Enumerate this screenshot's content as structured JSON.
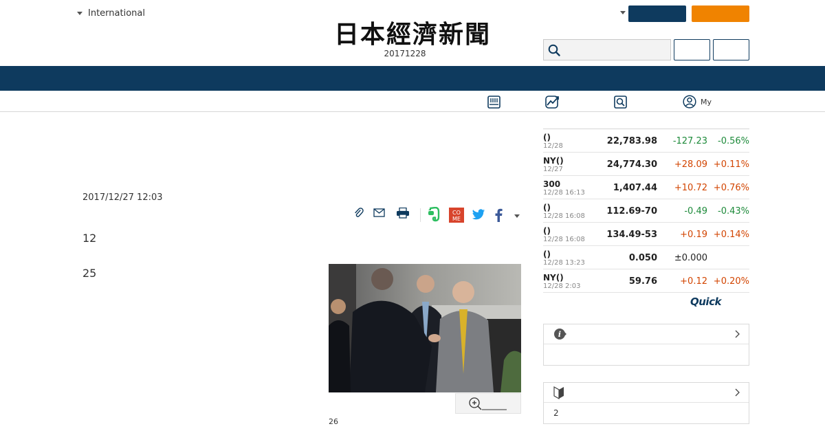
{
  "header": {
    "edition_label": "International",
    "logo_text": "日本經濟新聞",
    "logo_date": "20171228",
    "search": {
      "value": "",
      "placeholder": ""
    }
  },
  "subnav": {
    "items": [
      {
        "icon": "newspaper-icon",
        "label": ""
      },
      {
        "icon": "chart-icon",
        "label": ""
      },
      {
        "icon": "search-icon",
        "label": ""
      },
      {
        "icon": "user-icon",
        "label": "My"
      }
    ]
  },
  "article": {
    "date": "2017/12/27 12:03",
    "paragraph_1": "12",
    "paragraph_2": "25",
    "caption": "26"
  },
  "market": {
    "rows": [
      {
        "name": "()",
        "time": "12/28",
        "value": "22,783.98",
        "change": "-127.23",
        "pct": "-0.56%",
        "dir": "down"
      },
      {
        "name": "NY()",
        "time": "12/27",
        "value": "24,774.30",
        "change": "+28.09",
        "pct": "+0.11%",
        "dir": "up"
      },
      {
        "name": "300",
        "time": "12/28 16:13",
        "value": "1,407.44",
        "change": "+10.72",
        "pct": "+0.76%",
        "dir": "up"
      },
      {
        "name": "()",
        "time": "12/28 16:08",
        "value": "112.69-70",
        "change": "-0.49",
        "pct": "-0.43%",
        "dir": "down"
      },
      {
        "name": "()",
        "time": "12/28 16:08",
        "value": "134.49-53",
        "change": "+0.19",
        "pct": "+0.14%",
        "dir": "up"
      },
      {
        "name": "()",
        "time": "12/28 13:23",
        "value": "0.050",
        "change": "±0.000",
        "pct": "",
        "dir": "flat"
      },
      {
        "name": "NY()",
        "time": "12/28 2:03",
        "value": "59.76",
        "change": "+0.12",
        "pct": "+0.20%",
        "dir": "up"
      }
    ],
    "provider": "Quick"
  },
  "sideboxes": [
    {
      "icon": "info-icon",
      "title": "",
      "body": ""
    },
    {
      "icon": "beginner-mark-icon",
      "title": "",
      "body": "2"
    }
  ],
  "colors": {
    "navy": "#0e3a5e",
    "orange": "#f08300",
    "up": "#d24400",
    "down": "#1d8a3a"
  }
}
